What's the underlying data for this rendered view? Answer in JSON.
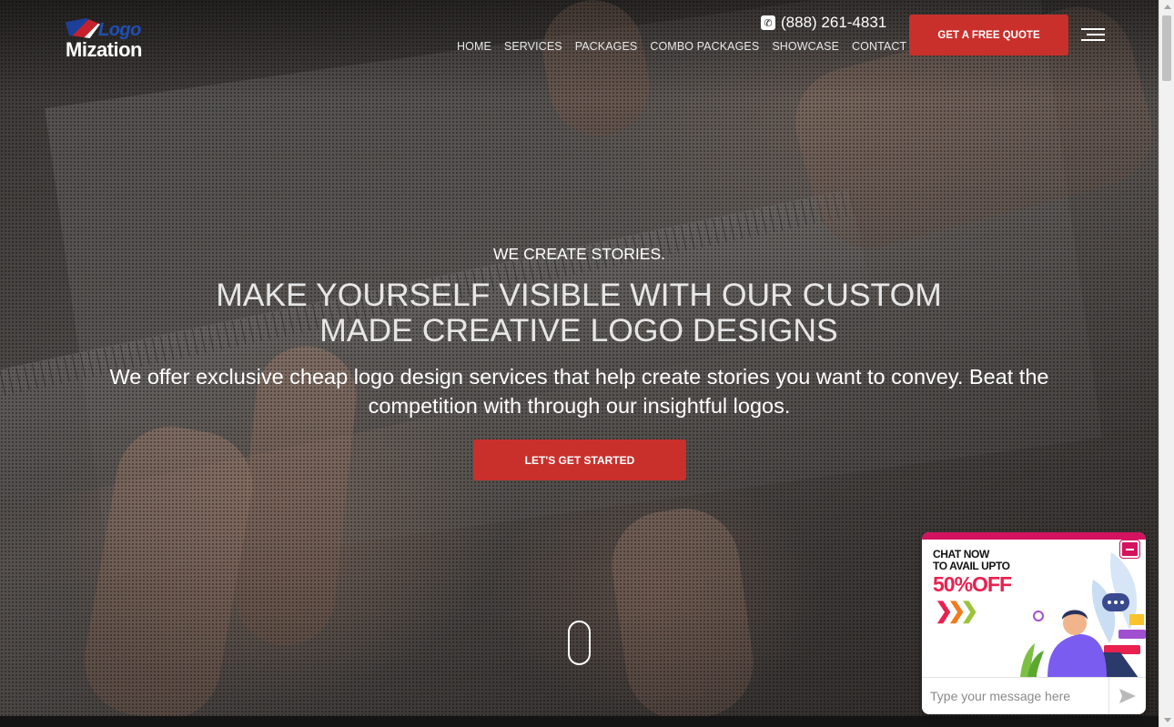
{
  "header": {
    "logo_top": "Logo",
    "logo_bottom": "Mization",
    "phone": "(888) 261-4831",
    "phone_icon": "phone-icon",
    "nav": [
      "HOME",
      "SERVICES",
      "PACKAGES",
      "COMBO PACKAGES",
      "SHOWCASE",
      "CONTACT"
    ],
    "quote_button": "GET A FREE QUOTE",
    "menu_icon": "hamburger-menu-icon"
  },
  "hero": {
    "eyebrow": "WE CREATE STORIES.",
    "headline_line1": "MAKE YOURSELF VISIBLE WITH OUR CUSTOM",
    "headline_line2": "MADE CREATIVE LOGO DESIGNS",
    "lead_line1": "We offer exclusive cheap logo design services that help create stories you want to convey. Beat the",
    "lead_line2": "competition with through our insightful logos.",
    "cta": "LET'S GET STARTED",
    "scroll_icon": "mouse-scroll-icon"
  },
  "chat": {
    "promo_line1": "CHAT NOW",
    "promo_line2": "TO AVAIL UPTO",
    "promo_offer": "50%OFF",
    "input_placeholder": "Type your message here",
    "send_icon": "send-icon",
    "minimize_icon": "minimize-icon",
    "accent": "#d3135f"
  },
  "colors": {
    "brand_red": "#c9302c",
    "logo_blue": "#1f4fb5"
  }
}
